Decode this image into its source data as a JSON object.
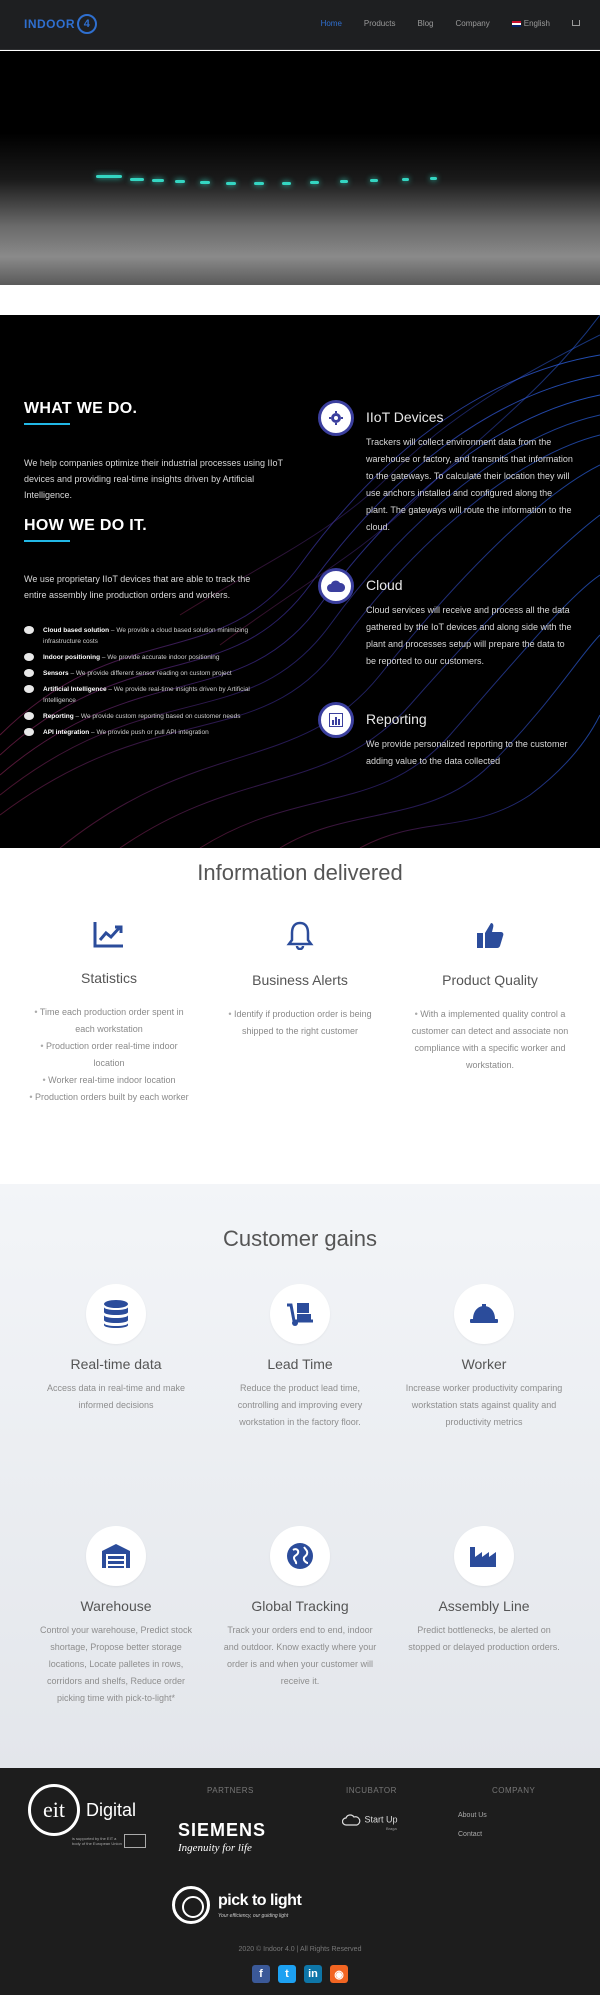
{
  "nav": {
    "logo_text": "INDOOR",
    "logo_number": "4",
    "items": [
      {
        "label": "Home",
        "active": true
      },
      {
        "label": "Products",
        "active": false
      },
      {
        "label": "Blog",
        "active": false
      },
      {
        "label": "Company",
        "active": false
      }
    ],
    "language": "English",
    "cart_icon": "cart-icon"
  },
  "what": {
    "title": "WHAT WE DO.",
    "text": "We help companies optimize their industrial processes using IIoT devices and providing real-time insights driven by Artificial Intelligence.",
    "how_title": "HOW WE DO IT.",
    "how_text": "We use proprietary IIoT devices that are able to track the entire assembly line production orders and workers.",
    "features": [
      {
        "icon": "cloud-icon",
        "name": "Cloud based solution",
        "desc": " – We provide a cloud based solution minimizing infrastructure costs"
      },
      {
        "icon": "location-pin-icon",
        "name": "Indoor positioning",
        "desc": " – We provide accurate indoor positioning"
      },
      {
        "icon": "thermometer-icon",
        "name": "Sensors",
        "desc": " – We provide different sensor reading on custom project"
      },
      {
        "icon": "brain-icon",
        "name": "Artificial Intelligence",
        "desc": " – We provide real-time insights driven by Artificial Intelligence"
      },
      {
        "icon": "chart-icon",
        "name": "Reporting",
        "desc": " – We provide custom reporting based on customer needs"
      },
      {
        "icon": "gear-icon",
        "name": "API integration",
        "desc": " – We provide push or pull API integration"
      }
    ],
    "steps": [
      {
        "icon": "gear-icon",
        "title": "IIoT Devices",
        "text": "Trackers will collect environment data from the warehouse or factory, and transmits that information to the gateways. To calculate their location they will use anchors installed and configured along the plant. The gateways will route the information to the cloud."
      },
      {
        "icon": "cloud-icon",
        "title": "Cloud",
        "text": "Cloud services will receive and process all the data gathered by the IoT devices and along side with the plant and processes setup will prepare the data to be reported to our customers."
      },
      {
        "icon": "report-icon",
        "title": "Reporting",
        "text": "We provide personalized reporting to the customer adding value to the data collected"
      }
    ]
  },
  "info": {
    "title": "Information delivered",
    "columns": [
      {
        "icon": "chart-line-icon",
        "title": "Statistics",
        "items": [
          "Time each production order spent in each workstation",
          "Production order real-time indoor location",
          "Worker real-time indoor location",
          "Production orders built by each worker"
        ]
      },
      {
        "icon": "bell-icon",
        "title": "Business Alerts",
        "items": [
          "Identify if production order is being shipped to the right customer"
        ]
      },
      {
        "icon": "thumbs-up-icon",
        "title": "Product Quality",
        "items": [
          "With a implemented quality control a customer can detect and associate non compliance with a specific worker and workstation."
        ]
      }
    ]
  },
  "gains": {
    "title": "Customer gains",
    "items": [
      {
        "icon": "database-icon",
        "title": "Real-time data",
        "text": "Access data in real-time and make informed decisions"
      },
      {
        "icon": "dolly-icon",
        "title": "Lead Time",
        "text": "Reduce the product lead time, controlling and improving every workstation in the factory floor."
      },
      {
        "icon": "hard-hat-icon",
        "title": "Worker",
        "text": "Increase worker productivity comparing workstation stats against quality and productivity metrics"
      },
      {
        "icon": "warehouse-icon",
        "title": "Warehouse",
        "text": "Control your warehouse, Predict stock shortage, Propose better storage locations, Locate palletes in rows, corridors and shelfs, Reduce order picking time with pick-to-light*"
      },
      {
        "icon": "globe-icon",
        "title": "Global Tracking",
        "text": "Track your orders end to end, indoor and outdoor. Know exactly where your order is and when your customer will receive it."
      },
      {
        "icon": "factory-icon",
        "title": "Assembly Line",
        "text": "Predict bottlenecks, be alerted on stopped or delayed production orders."
      }
    ]
  },
  "footer": {
    "partners_head": "PARTNERS",
    "incubator_head": "INCUBATOR",
    "company_head": "COMPANY",
    "eit_mark": "eit",
    "eit_digital": "Digital",
    "eit_small": "is supported by the EIT a body of the European Union",
    "siemens": "SIEMENS",
    "siemens_tag": "Ingenuity for life",
    "startup": "Start Up",
    "startup_sub": "Braga",
    "company_links": [
      "About Us",
      "Contact"
    ],
    "pick_name": "pick to light",
    "pick_tag": "Your efficiency, our guiding light",
    "copyright": "2020 © Indoor 4.0 | All Rights Reserved",
    "socials": [
      {
        "icon": "facebook-icon",
        "glyph": "f",
        "color": "#3b5998"
      },
      {
        "icon": "twitter-icon",
        "glyph": "t",
        "color": "#1da1f2"
      },
      {
        "icon": "linkedin-icon",
        "glyph": "in",
        "color": "#0e76a8"
      },
      {
        "icon": "rss-icon",
        "glyph": "◉",
        "color": "#f26522"
      }
    ]
  }
}
